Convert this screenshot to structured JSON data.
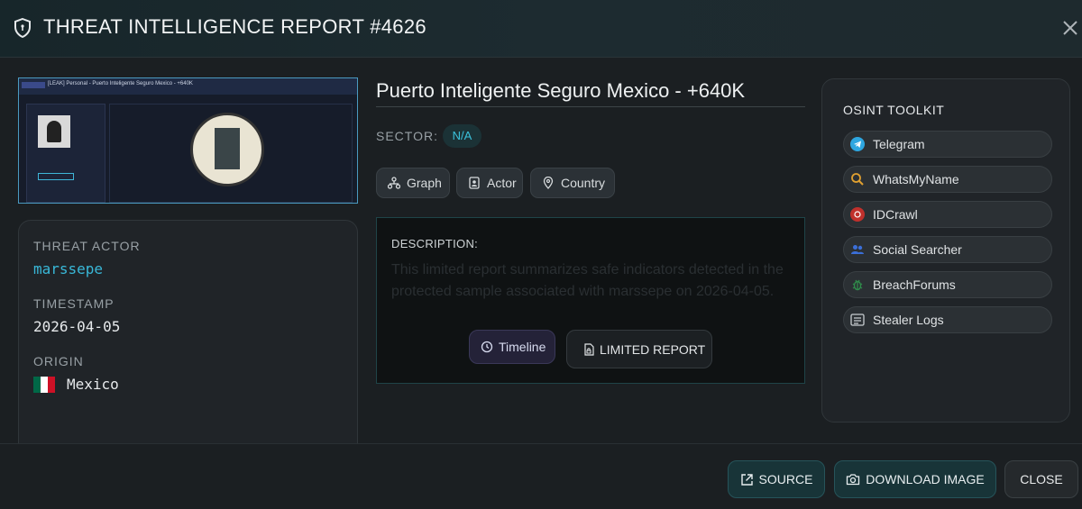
{
  "header": {
    "title": "THREAT INTELLIGENCE REPORT #4626"
  },
  "thumbnail": {
    "tag": "DATABASE",
    "caption": "[LEAK] Personal - Puerto Inteligente Seguro Mexico - +640K",
    "seal_text": "MARINA"
  },
  "report": {
    "title": "Puerto Inteligente Seguro Mexico - +640K",
    "sector_label": "SECTOR:",
    "sector_value": "N/A",
    "chips": [
      "Graph",
      "Actor",
      "Country"
    ]
  },
  "details": {
    "actor_label": "THREAT ACTOR",
    "actor_value": "marssepe",
    "timestamp_label": "TIMESTAMP",
    "timestamp_value": "2026-04-05",
    "origin_label": "ORIGIN",
    "origin_value": "Mexico",
    "flag_colors": [
      "#006847",
      "#ffffff",
      "#ce1126"
    ]
  },
  "description": {
    "label": "DESCRIPTION:",
    "text": "This limited report summarizes safe indicators detected in the protected sample associated with marssepe on 2026-04-05.",
    "timeline_button": "Timeline",
    "limited_button": "LIMITED REPORT"
  },
  "osint": {
    "title": "OSINT TOOLKIT",
    "tools": [
      {
        "label": "Telegram",
        "icon": "telegram-icon",
        "color": "#2ea6e0"
      },
      {
        "label": "WhatsMyName",
        "icon": "search-icon",
        "color": "#e0a030"
      },
      {
        "label": "IDCrawl",
        "icon": "idcrawl-icon",
        "color": "#c0302c"
      },
      {
        "label": "Social Searcher",
        "icon": "users-icon",
        "color": "#3b6fd8"
      },
      {
        "label": "BreachForums",
        "icon": "bug-icon",
        "color": "#2f8a4a"
      },
      {
        "label": "Stealer Logs",
        "icon": "terminal-icon",
        "color": "#c8cdd0"
      }
    ]
  },
  "footer": {
    "source_button": "SOURCE",
    "download_button": "DOWNLOAD IMAGE",
    "close_button": "CLOSE"
  }
}
